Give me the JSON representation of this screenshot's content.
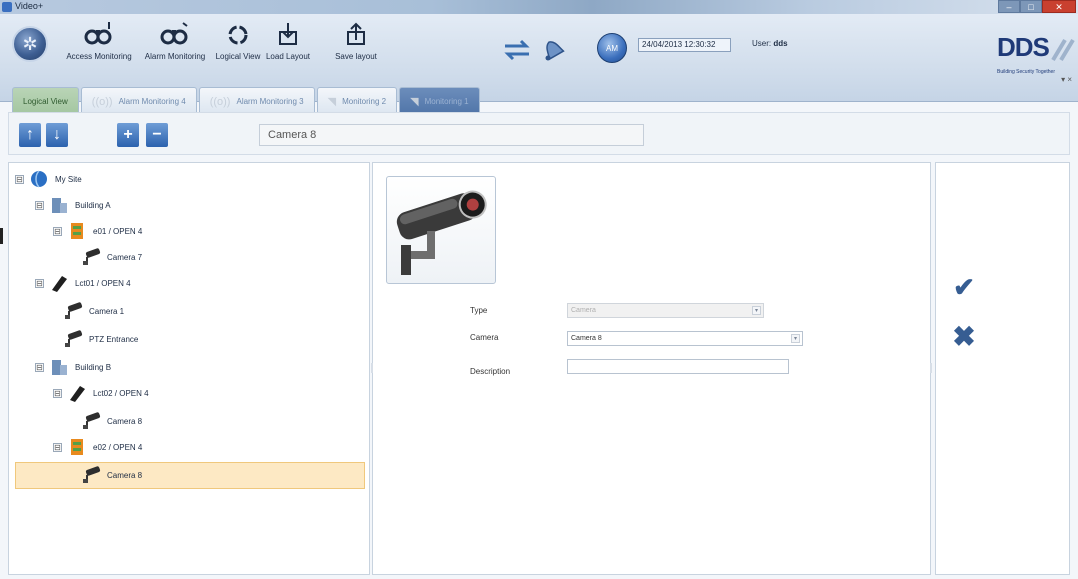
{
  "window": {
    "title": "Video+",
    "controls": [
      "–",
      "□",
      "✕"
    ]
  },
  "ribbon": {
    "buttons": {
      "access_monitoring": "Access Monitoring",
      "alarm_monitoring": "Alarm Monitoring",
      "logical_view": "Logical View",
      "load_layout": "Load Layout",
      "save_layout": "Save layout"
    },
    "am_badge": "AM",
    "datetime": "24/04/2013 12:30:32",
    "user_label": "User:",
    "user_name": "dds",
    "logo": {
      "brand": "DDS",
      "tagline": "Building Security Together",
      "mini_controls": "▾ ×"
    }
  },
  "tabs": [
    {
      "label": "Logical View",
      "active": true
    },
    {
      "label": "Alarm Monitoring 4",
      "active": false
    },
    {
      "label": "Alarm Monitoring 3",
      "active": false
    },
    {
      "label": "Monitoring 2",
      "active": false
    },
    {
      "label": "Monitoring 1",
      "active": false
    }
  ],
  "toolbar": {
    "name_value": "Camera 8"
  },
  "tree": {
    "nodes": [
      {
        "label": "My Site",
        "icon": "globe-icon",
        "expander": "⊟"
      },
      {
        "label": "Building A",
        "icon": "building-icon",
        "expander": "⊟"
      },
      {
        "label": "e01 / OPEN 4",
        "icon": "controller-icon",
        "expander": "⊟"
      },
      {
        "label": "Camera 7",
        "icon": "camera-icon"
      },
      {
        "label": "Lct01 / OPEN 4",
        "icon": "reader-icon",
        "expander": "⊟"
      },
      {
        "label": "Camera 1",
        "icon": "camera-icon"
      },
      {
        "label": "PTZ Entrance",
        "icon": "camera-icon"
      },
      {
        "label": "Building B",
        "icon": "building-icon",
        "expander": "⊟"
      },
      {
        "label": "Lct02 / OPEN 4",
        "icon": "reader-icon",
        "expander": "⊟"
      },
      {
        "label": "Camera 8",
        "icon": "camera-icon"
      },
      {
        "label": "e02 / OPEN 4",
        "icon": "controller-icon",
        "expander": "⊟"
      },
      {
        "label": "Camera 8",
        "icon": "camera-icon",
        "selected": true
      }
    ]
  },
  "detail": {
    "type_label": "Type",
    "type_value": "Camera",
    "camera_label": "Camera",
    "camera_value": "Camera 8",
    "description_label": "Description",
    "description_value": ""
  },
  "actions": {
    "ok_icon": "✔",
    "cancel_icon": "✖"
  },
  "colors": {
    "accent_blue": "#2c62ae",
    "selection": "#fde9c4",
    "active_tab": "#a3c6a0"
  }
}
